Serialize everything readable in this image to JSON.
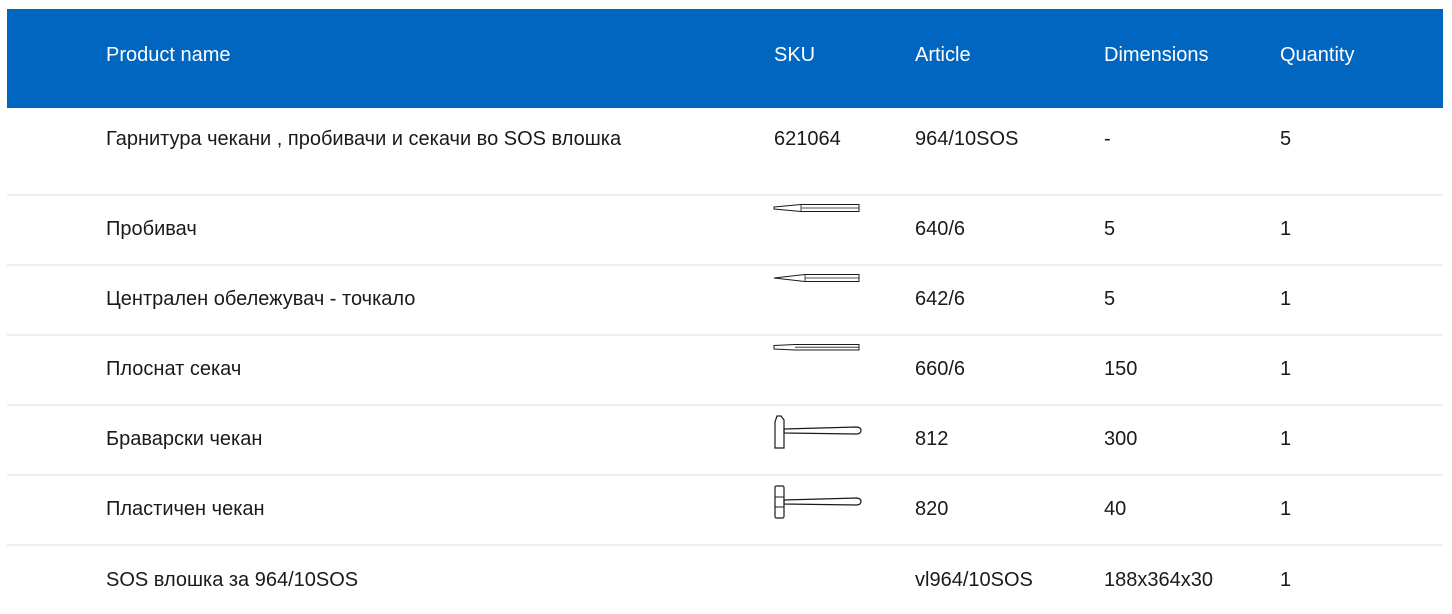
{
  "table": {
    "headers": {
      "name": "Product name",
      "sku": "SKU",
      "article": "Article",
      "dimensions": "Dimensions",
      "quantity": "Quantity"
    },
    "rows": [
      {
        "name": "Гарнитура чекани , пробивачи и секачи во SOS влошка",
        "sku": "621064",
        "article": "964/10SOS",
        "dimensions": "-",
        "quantity": "5"
      },
      {
        "name": "Пробивач",
        "sku_icon": "punch-icon",
        "article": "640/6",
        "dimensions": "5",
        "quantity": "1"
      },
      {
        "name": "Централен обележувач - точкало",
        "sku_icon": "center-punch-icon",
        "article": "642/6",
        "dimensions": "5",
        "quantity": "1"
      },
      {
        "name": "Плоснат секач",
        "sku_icon": "flat-chisel-icon",
        "article": "660/6",
        "dimensions": "150",
        "quantity": "1"
      },
      {
        "name": "Браварски чекан",
        "sku_icon": "locksmith-hammer-icon",
        "article": "812",
        "dimensions": "300",
        "quantity": "1"
      },
      {
        "name": "Пластичен чекан",
        "sku_icon": "plastic-hammer-icon",
        "article": "820",
        "dimensions": "40",
        "quantity": "1"
      },
      {
        "name": "SOS влошка за 964/10SOS",
        "sku": "",
        "article": "vl964/10SOS",
        "dimensions": "188x364x30",
        "quantity": "1"
      }
    ]
  },
  "colors": {
    "header_bg": "#0066bf",
    "header_text": "#ffffff",
    "divider": "#eeeeee"
  }
}
